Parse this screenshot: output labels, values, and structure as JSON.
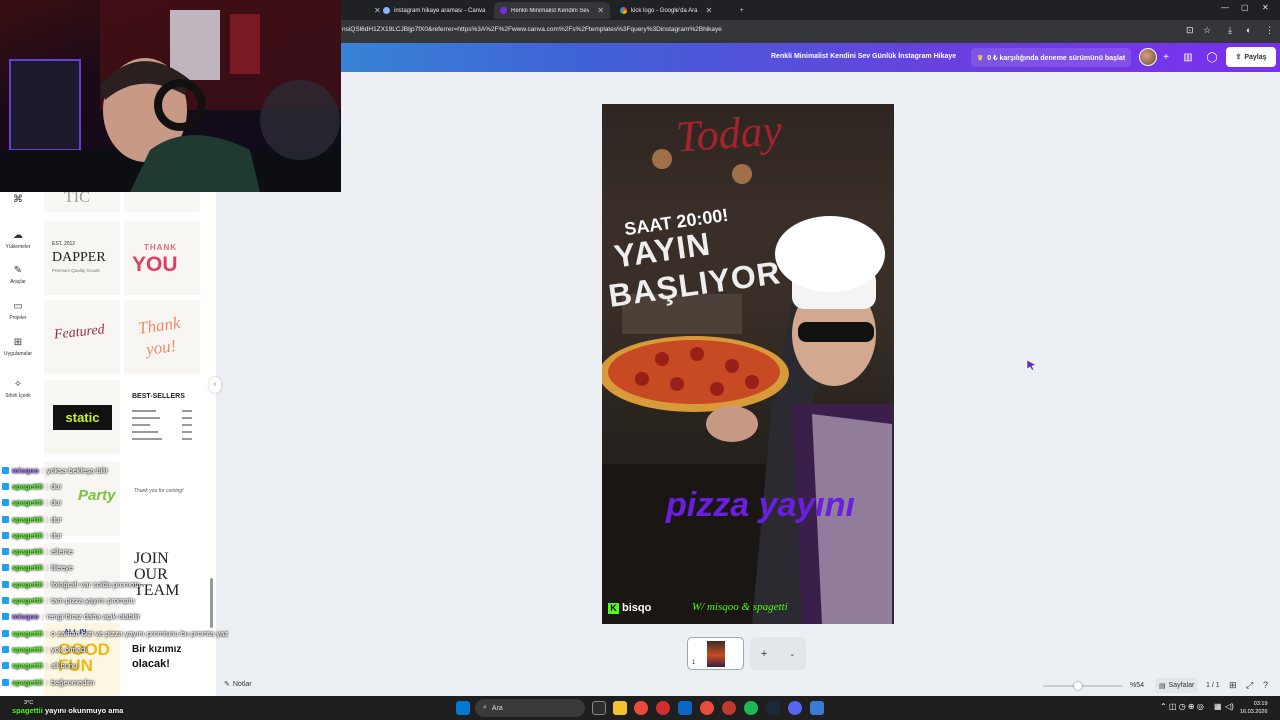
{
  "browser": {
    "tabs": [
      {
        "label": "instagram hikaye araması - Canva",
        "icon": "canva-favicon",
        "active": false
      },
      {
        "label": "Renkli Minimalist Kendini Sev Günlük",
        "icon": "canva-favicon",
        "active": true
      },
      {
        "label": "kick logo - Google'da Ara",
        "icon": "google-favicon",
        "active": false
      }
    ],
    "new_tab": "+",
    "url": "nsiQSl6dH1ZX19LCJBljp7fX0&referrer=https%3A%2F%2Fwww.canva.com%2Fs%2Ftemplates%3Fquery%3Dinstagram%2Bhikaye"
  },
  "canva_header": {
    "doc_title": "Renkli Minimalist Kendini Sev Günlük İnstagram Hikaye",
    "trial_label": "0 ₺ karşılığında deneme sürümünü başlat",
    "share_label": "Paylaş"
  },
  "sidebar": {
    "items": [
      {
        "label": "Yüklemeler",
        "icon": "cloud-upload-icon"
      },
      {
        "label": "Araçlar",
        "icon": "pen-tool-icon"
      },
      {
        "label": "Projeler",
        "icon": "folder-icon"
      },
      {
        "label": "Uygulamalar",
        "icon": "apps-grid-icon"
      },
      {
        "label": "Sihirli İçerik",
        "icon": "magic-media-icon"
      }
    ]
  },
  "templates": {
    "dapper_est": "EST. 2012",
    "dapper_title": "DAPPER",
    "dapper_sub": "Premium Quality Goods",
    "thank_top": "THANK",
    "thank_you": "YOU",
    "featured": "Featured",
    "thank_script_1": "Thank",
    "thank_script_2": "you!",
    "static": "static",
    "best_sellers": "BEST-SELLERS",
    "party": "Party",
    "thanks_coming": "Thank you for coming!",
    "join_1": "JOIN",
    "join_2": "OUR",
    "join_3": "TEAM",
    "good_fun": "GOOD FUN",
    "all_in": "ALL IN",
    "kizimiz_1": "Bir kızımız",
    "kizimiz_2": "olacak!"
  },
  "design": {
    "today": "Today",
    "saat": "SAAT 20:00!",
    "yayin": "YAYIN",
    "basliyor": "BAŞLIYOR",
    "pizza": "pizza yayını",
    "brand": "bisqo",
    "footer_script": "W/ misqoo & spagetti"
  },
  "chat": [
    {
      "user": "misqoo",
      "color": "purple",
      "msg": "yoksa bekleşa bilir"
    },
    {
      "user": "spagettii",
      "color": "green",
      "msg": "dur"
    },
    {
      "user": "spagettii",
      "color": "green",
      "msg": "dur"
    },
    {
      "user": "spagettii",
      "color": "green",
      "msg": "dur"
    },
    {
      "user": "spagettii",
      "color": "green",
      "msg": "dur"
    },
    {
      "user": "spagettii",
      "color": "green",
      "msg": "elleme"
    },
    {
      "user": "spagettii",
      "color": "green",
      "msg": "bleeye"
    },
    {
      "user": "spagettii",
      "color": "green",
      "msg": "fotoğrafı var solda promotu"
    },
    {
      "user": "spagettii",
      "color": "green",
      "msg": "tam pizza yayını promptu"
    },
    {
      "user": "misqoo",
      "color": "purple",
      "msg": "rengi biraz daha açık olabilir"
    },
    {
      "user": "spagettii",
      "color": "green",
      "msg": "o zaman bizi ve pizza yayını promtunu bu promta yaz"
    },
    {
      "user": "spagettii",
      "color": "green",
      "msg": "yok olmadı"
    },
    {
      "user": "spagettii",
      "color": "green",
      "msg": "all bunu"
    },
    {
      "user": "spagettii",
      "color": "green",
      "msg": "beğenmedim"
    }
  ],
  "ticker": {
    "user": "spagettii",
    "msg": "yayını okunmuyo ama"
  },
  "footer": {
    "notes_label": "Notlar",
    "page_number": "1",
    "zoom": "%54",
    "zoom_fraction": 0.54,
    "pages_label": "Sayfalar",
    "page_count": "1 / 1"
  },
  "taskbar": {
    "weather_temp": "3°C",
    "weather_desc": "",
    "search_label": "Ara",
    "time": "03:19",
    "date": "16.03.2026"
  }
}
